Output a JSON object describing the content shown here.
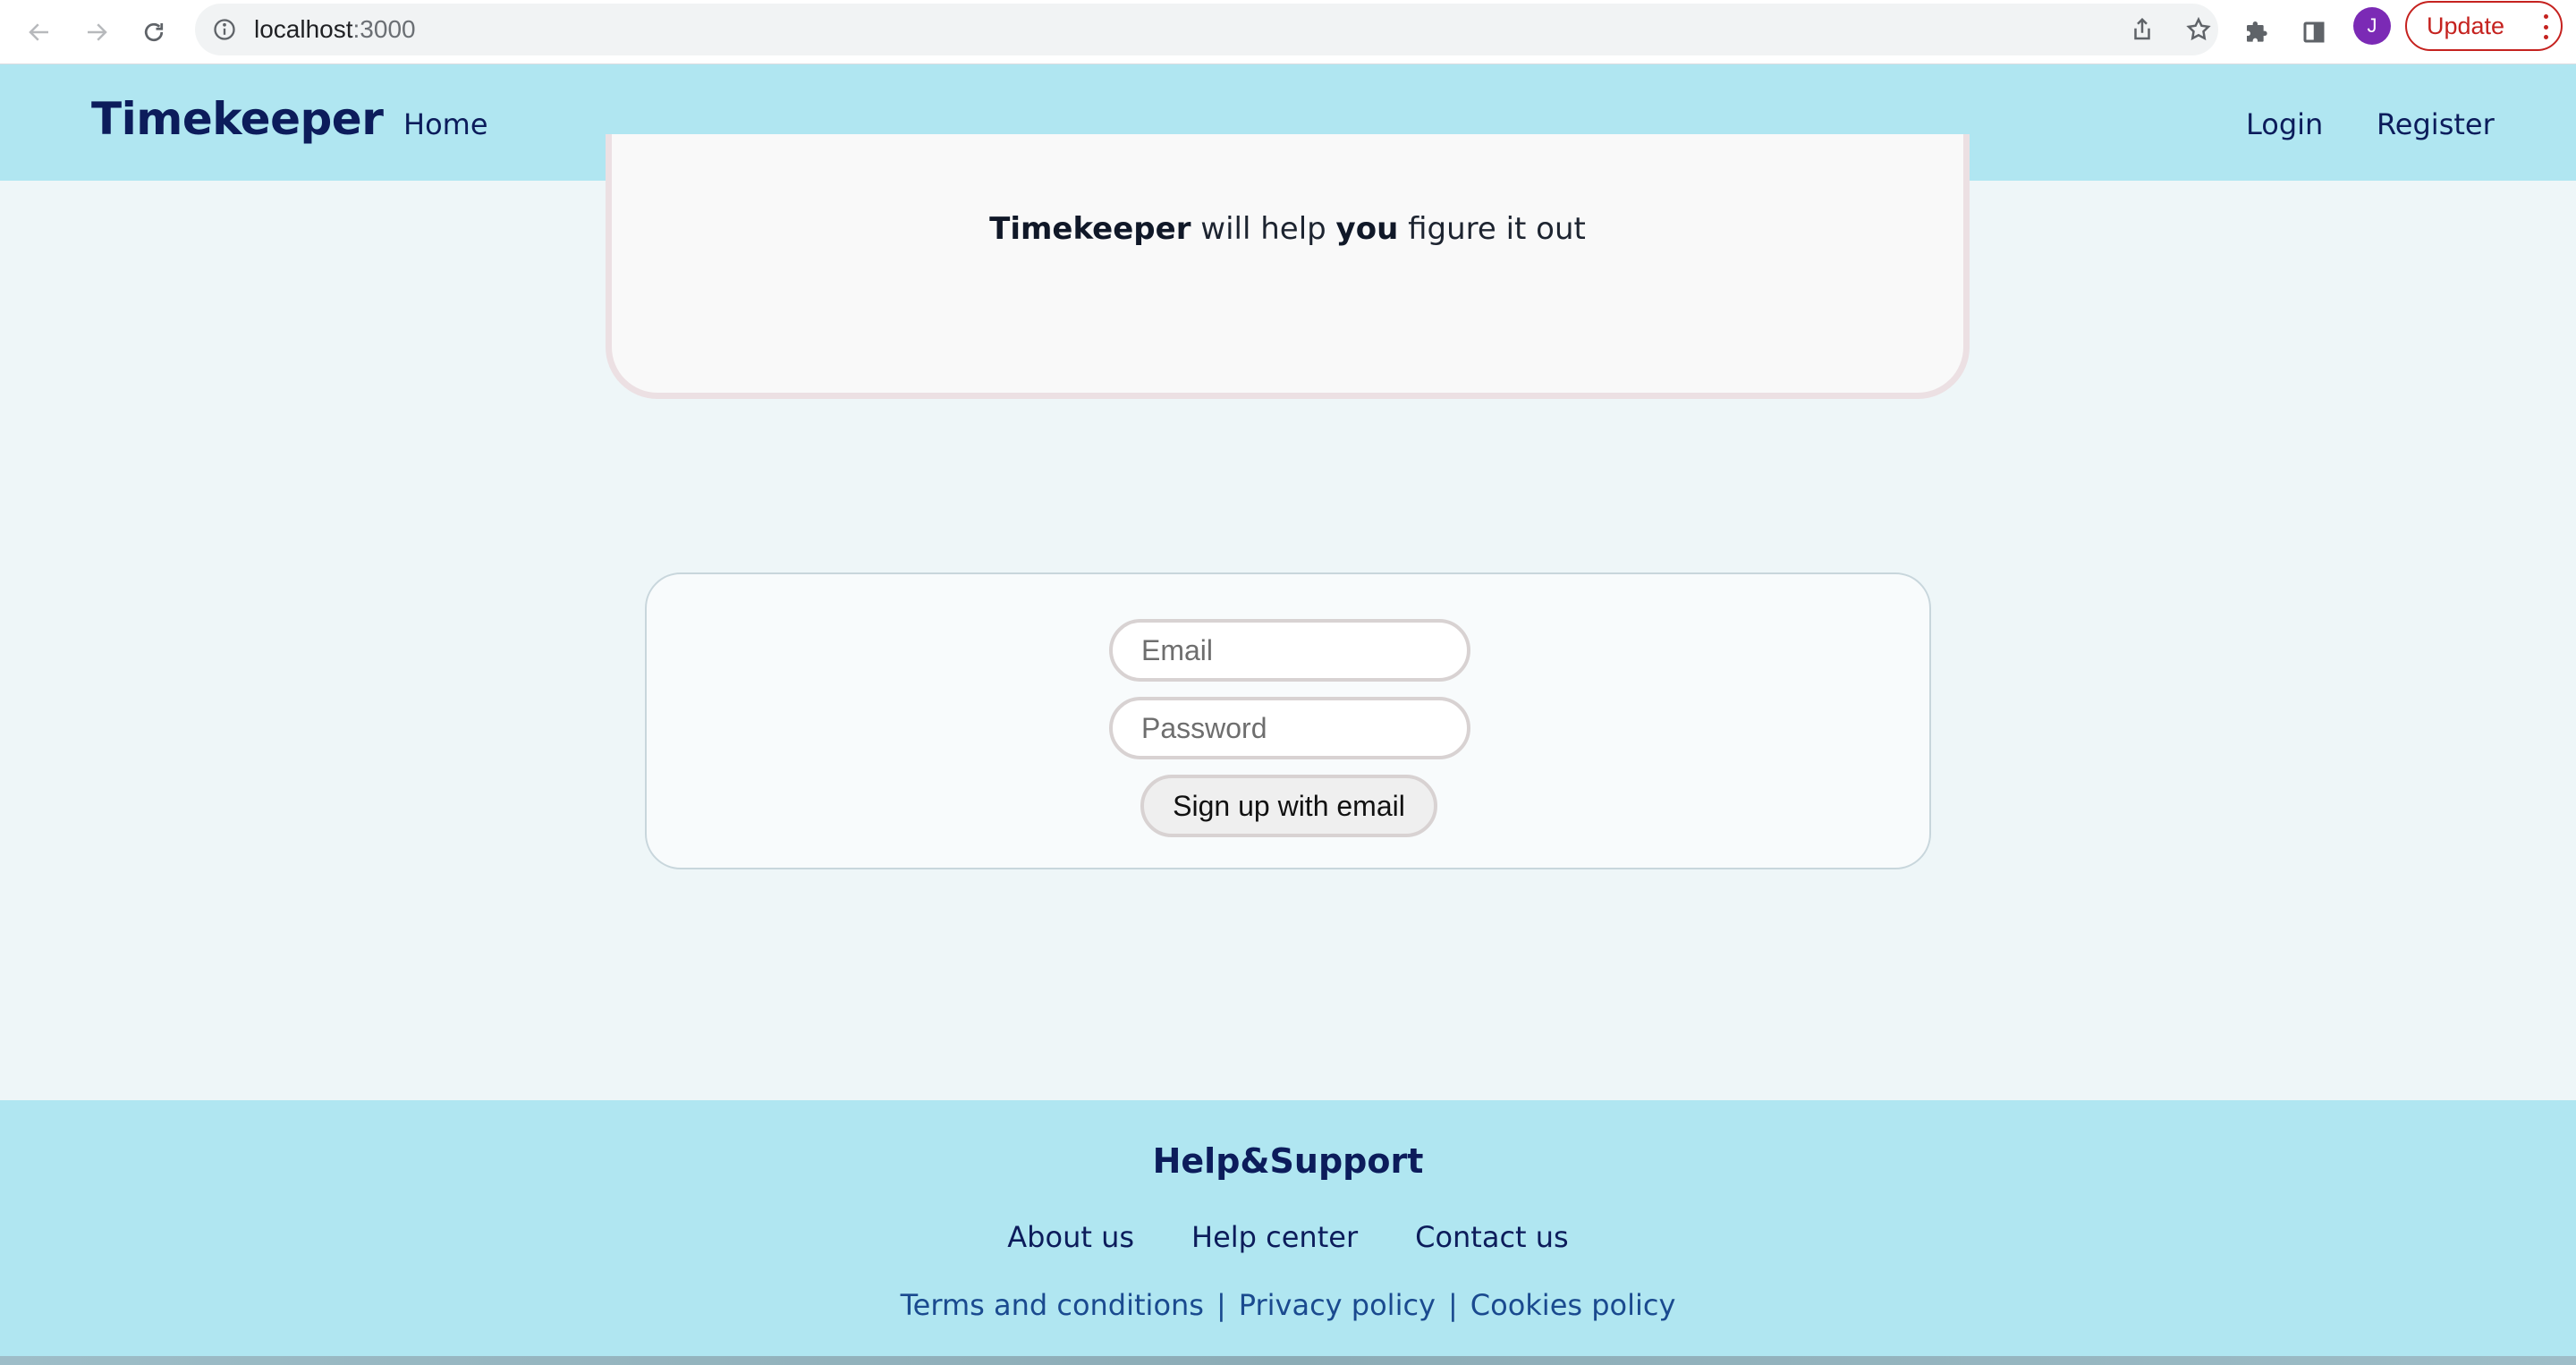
{
  "browser": {
    "url_host": "localhost",
    "url_port": ":3000",
    "profile_initial": "J",
    "update_label": "Update"
  },
  "header": {
    "brand": "Timekeeper",
    "nav": {
      "home": "Home"
    },
    "auth": {
      "login": "Login",
      "register": "Register"
    }
  },
  "hero": {
    "brand_word": "Timekeeper",
    "text_middle": " will help ",
    "emphasis": "you",
    "text_end": " figure it out"
  },
  "signup": {
    "email_placeholder": "Email",
    "password_placeholder": "Password",
    "submit_label": "Sign up with email"
  },
  "footer": {
    "title": "Help&Support",
    "links": [
      "About us",
      "Help center",
      "Contact us"
    ],
    "legal": [
      "Terms and conditions",
      "Privacy policy",
      "Cookies policy"
    ],
    "separator": "|"
  },
  "colors": {
    "header_bg": "#b0e6f1",
    "page_bg": "#eef6f8",
    "brand_text": "#0c1c5b",
    "update_red": "#c5221f",
    "avatar_purple": "#7b2ab5"
  },
  "icons": {
    "back": "arrow-left-icon",
    "forward": "arrow-right-icon",
    "reload": "reload-icon",
    "site_info": "info-icon",
    "share": "share-icon",
    "bookmark": "star-icon",
    "extensions": "puzzle-icon",
    "side_panel": "side-panel-icon",
    "menu": "kebab-menu-icon"
  }
}
